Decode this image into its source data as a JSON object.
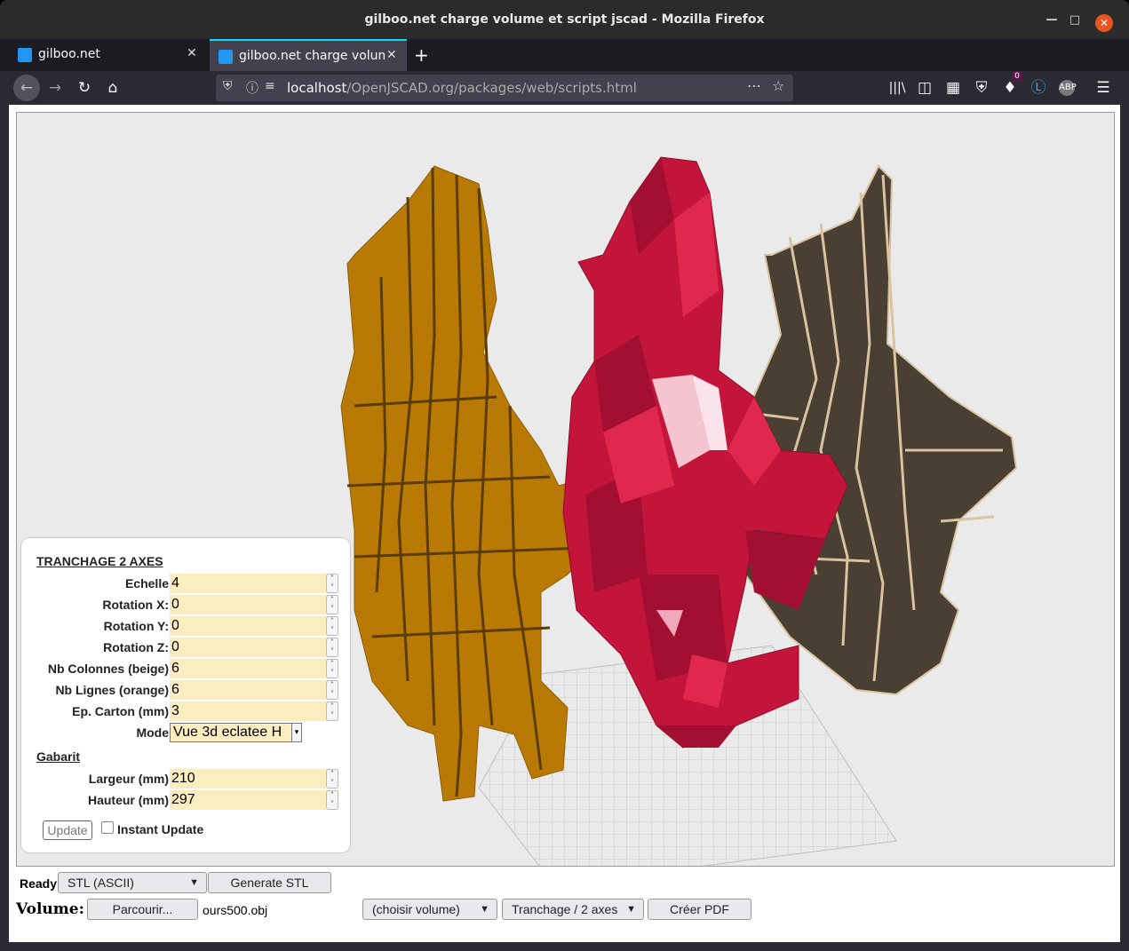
{
  "window": {
    "title": "gilboo.net charge volume et script jscad - Mozilla Firefox"
  },
  "tabs": [
    {
      "label": "gilboo.net",
      "active": false
    },
    {
      "label": "gilboo.net charge volume",
      "active": true
    }
  ],
  "nav": {
    "url_host": "localhost",
    "url_path": "/OpenJSCAD.org/packages/web/scripts.html",
    "notification_count": "0"
  },
  "params": {
    "section1": "TRANCHAGE 2 AXES",
    "fields": [
      {
        "label": "Echelle",
        "value": "4"
      },
      {
        "label": "Rotation X:",
        "value": "0"
      },
      {
        "label": "Rotation Y:",
        "value": "0"
      },
      {
        "label": "Rotation Z:",
        "value": "0"
      },
      {
        "label": "Nb Colonnes (beige)",
        "value": "6"
      },
      {
        "label": "Nb Lignes (orange)",
        "value": "6"
      },
      {
        "label": "Ep. Carton (mm)",
        "value": "3"
      }
    ],
    "mode": {
      "label": "Mode",
      "value": "Vue 3d eclatee H"
    },
    "section2": "Gabarit",
    "gabarit": [
      {
        "label": "Largeur (mm)",
        "value": "210"
      },
      {
        "label": "Hauteur (mm)",
        "value": "297"
      }
    ],
    "update_label": "Update",
    "instant_label": "Instant Update"
  },
  "bottom": {
    "status": "Ready",
    "format": "STL (ASCII)",
    "generate": "Generate STL",
    "volume_label": "Volume:",
    "browse": "Parcourir...",
    "filename": "ours500.obj",
    "choose_volume": "(choisir volume)",
    "slicing": "Tranchage / 2 axes",
    "pdf": "Créer PDF"
  },
  "colors": {
    "orange_slices": "#b87a05",
    "red_bear": "#c3143a",
    "brown_slices": "#4a3f33",
    "beige_edges": "#d9c4a2"
  }
}
